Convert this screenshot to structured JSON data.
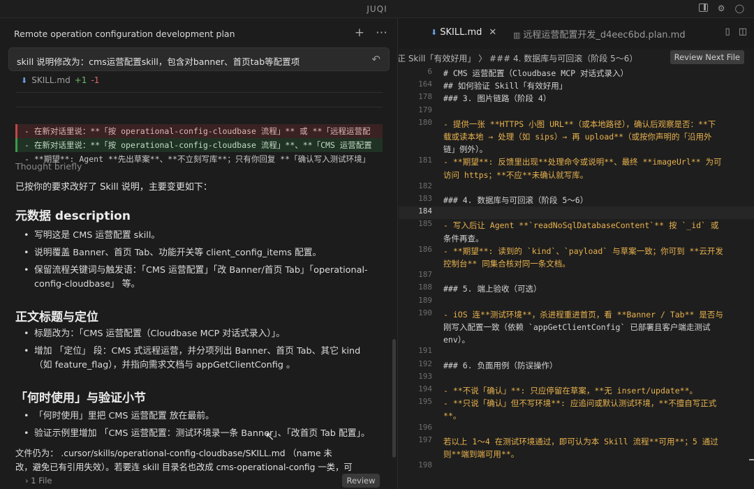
{
  "window": {
    "title": "JUQI"
  },
  "chat": {
    "plan_title": "Remote operation configuration development plan",
    "user_message": "skill 说明修改为：cms运营配置skill，包含对banner、首页tab等配置项",
    "diff": {
      "file": "SKILL.md",
      "added": "+1",
      "removed": "-1",
      "line_removed": "- 在新对话里说：**「按 operational-config-cloudbase 流程」** 或 **「远程运营配",
      "line_added": "- 在新对话里说：**「按 operational-config-cloudbase 流程」**、**「CMS 运营配置",
      "line_plain": "- **期望**: Agent **先出草案**、**不立刻写库**；只有你回复 **「确认写入测试环境」"
    },
    "thought": "Thought briefly",
    "intro": "已按你的要求改好了 Skill 说明，主要变更如下：",
    "sections": [
      {
        "heading": "元数据 description",
        "bullets": [
          "写明这是 CMS 运营配置 skill。",
          "说明覆盖 Banner、首页 Tab、功能开关等 client_config_items 配置。",
          "保留流程关键词与触发语：「CMS 运营配置」「改 Banner/首页 Tab」「operational-config-cloudbase」 等。"
        ]
      },
      {
        "heading": "正文标题与定位",
        "bullets": [
          "标题改为：「CMS 运营配置（Cloudbase MCP 对话式录入）」。",
          "增加 「定位」 段：CMS 式远程运营，并分项列出 Banner、首页 Tab、其它 kind （如 feature_flag），并指向需求文档与 appGetClientConfig 。"
        ]
      },
      {
        "heading": "「何时使用」与验证小节",
        "bullets": [
          "「何时使用」里把 CMS 运营配置 放在最前。",
          "验证示例里增加 「CMS 运营配置：测试环境录一条 Banner」、「改首页 Tab 配置」。"
        ]
      }
    ],
    "file_note_1": "文件仍为： .cursor/skills/operational-config-cloudbase/SKILL.md （name 未",
    "file_note_2": "改，避免已有引用失效）。若要连 skill 目录名也改成 cms-operational-config 一类，可",
    "footer_files": "1 File",
    "review_button": "Review"
  },
  "editor": {
    "tabs": [
      {
        "label": "SKILL.md",
        "active": true
      },
      {
        "label": "远程运营配置开发_d4eec6bd.plan.md",
        "active": false
      }
    ],
    "breadcrumb": "正 Skill「有效好用」 〉 ### 4. 数据库与可回滚（阶段 5～6）",
    "review_next": "Review Next File",
    "lines": [
      {
        "n": "6",
        "t": "# CMS 运营配置（Cloudbase MCP 对话式录入）"
      },
      {
        "n": "164",
        "t": "## 如何验证 Skill「有效好用」"
      },
      {
        "n": "178",
        "t": "### 3. 图片链路（阶段 4）"
      },
      {
        "n": "179",
        "t": ""
      },
      {
        "n": "180",
        "t": "- 提供一张 **HTTPS 小图 URL**（或本地路径），确认后观察是否：**下"
      },
      {
        "n": "",
        "t": "载或读本地 → 处理（如 sips）→ 再 upload**（或按你声明的「沿用外"
      },
      {
        "n": "",
        "t": "链」例外）。"
      },
      {
        "n": "181",
        "t": "- **期望**: 反馈里出现**处理命令或说明**、最终 **imageUrl** 为可"
      },
      {
        "n": "",
        "t": "访问 https；**不应**未确认就写库。"
      },
      {
        "n": "182",
        "t": ""
      },
      {
        "n": "183",
        "t": "### 4. 数据库与可回滚（阶段 5～6）"
      },
      {
        "n": "184",
        "t": ""
      },
      {
        "n": "185",
        "t": "- 写入后让 Agent **`readNoSqlDatabaseContent`** 按 `_id` 或"
      },
      {
        "n": "",
        "t": "条件再查。"
      },
      {
        "n": "186",
        "t": "- **期望**: 读到的 `kind`、`payload` 与草案一致；你可到 **云开发"
      },
      {
        "n": "",
        "t": "控制台** 同集合核对同一条文档。"
      },
      {
        "n": "187",
        "t": ""
      },
      {
        "n": "188",
        "t": "### 5. 端上验收（可选）"
      },
      {
        "n": "189",
        "t": ""
      },
      {
        "n": "190",
        "t": "- iOS 连**测试环境**，杀进程重进首页，看 **Banner / Tab** 是否与"
      },
      {
        "n": "",
        "t": "刚写入配置一致（依赖 `appGetClientConfig` 已部署且客户端走测试"
      },
      {
        "n": "",
        "t": "env）。"
      },
      {
        "n": "191",
        "t": ""
      },
      {
        "n": "192",
        "t": "### 6. 负面用例（防误操作）"
      },
      {
        "n": "193",
        "t": ""
      },
      {
        "n": "194",
        "t": "- **不说「确认」**: 只应停留在草案，**无 insert/update**。"
      },
      {
        "n": "195",
        "t": "- **只说「确认」但不写环境**: 应追问或默认测试环境，**不擅自写正式"
      },
      {
        "n": "",
        "t": "**。"
      },
      {
        "n": "196",
        "t": ""
      },
      {
        "n": "197",
        "t": "若以上 1～4 在测试环境通过，即可认为本 Skill 流程**可用**；5 通过"
      },
      {
        "n": "",
        "t": "则**端到端可用**。"
      },
      {
        "n": "198",
        "t": ""
      }
    ]
  }
}
